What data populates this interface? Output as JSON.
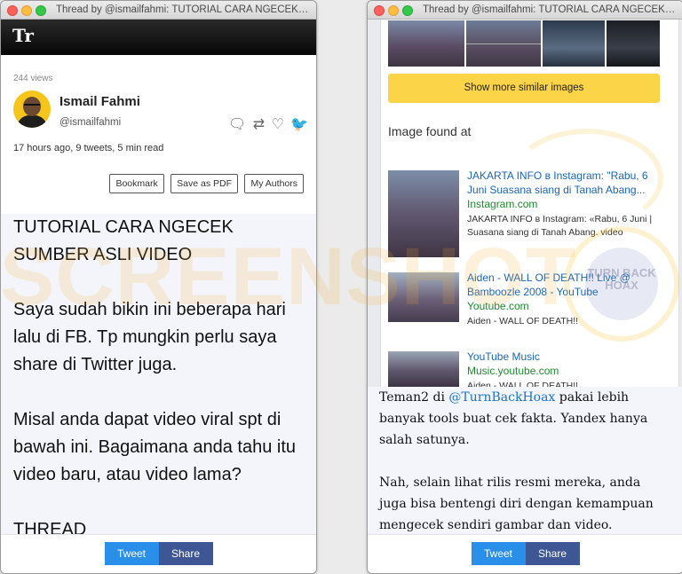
{
  "left_window": {
    "title": "Thread by @ismailfahmi: TUTORIAL CARA NGECEK SUMBER ASLI VIDEO",
    "app_logo": "Tr",
    "views": "244 views",
    "author": {
      "name": "Ismail Fahmi",
      "handle": "@ismailfahmi"
    },
    "thread_meta": "17 hours ago, 9 tweets, 5 min read",
    "buttons": {
      "bookmark": "Bookmark",
      "save_pdf": "Save as PDF",
      "my_authors": "My Authors"
    },
    "paragraphs": [
      "TUTORIAL CARA NGECEK SUMBER ASLI VIDEO",
      "Saya sudah bikin ini beberapa hari lalu di FB. Tp mungkin perlu saya share di Twitter juga.",
      "Misal anda dapat video viral spt di bawah ini. Bagaimana anda tahu itu video baru, atau video lama?",
      "THREAD"
    ],
    "footer": {
      "tweet": "Tweet",
      "share": "Share"
    }
  },
  "right_window": {
    "title": "Thread by @ismailfahmi: TUTORIAL CARA NGECEK SUMBER ASLI VIDEO",
    "screenshot": {
      "show_more": "Show more similar images",
      "found_title": "Image found at",
      "results": [
        {
          "title": "JAKARTA INFO в Instagram: \"Rabu, 6 Juni Suasana siang di Tanah Abang...",
          "site": "Instagram.com",
          "desc": "JAKARTA INFO в Instagram: «Rabu, 6 Juni | Suasana siang di Tanah Abang. video"
        },
        {
          "title": "Aiden - WALL OF DEATH!! Live @ Bamboozle 2008 - YouTube",
          "site": "Youtube.com",
          "desc": "Aiden - WALL OF DEATH!!"
        },
        {
          "title": "YouTube Music",
          "site": "Music.youtube.com",
          "desc": "Aiden - WALL OF DEATH!!"
        }
      ]
    },
    "para1_pre": "Teman2 di ",
    "para1_mention": "@TurnBackHoax",
    "para1_post": " pakai lebih banyak tools buat cek fakta. Yandex hanya salah satunya.",
    "para2": "Nah, selain lihat rilis resmi mereka, anda juga bisa bentengi diri dengan kemampuan mengecek sendiri gambar dan video.",
    "footer": {
      "tweet": "Tweet",
      "share": "Share"
    }
  },
  "watermarks": {
    "screenshot_text": "SCREENSHOT",
    "seal_text": "TURN BACK HOAX"
  },
  "colors": {
    "tweet_blue": "#2a8fe8",
    "share_navy": "#3e5794",
    "yandex_yellow": "#fbd547",
    "link_blue": "#1a66b8",
    "site_green": "#1e8a2e"
  },
  "icons": [
    "comment-icon",
    "retweet-icon",
    "like-icon",
    "twitter-bird-icon"
  ]
}
